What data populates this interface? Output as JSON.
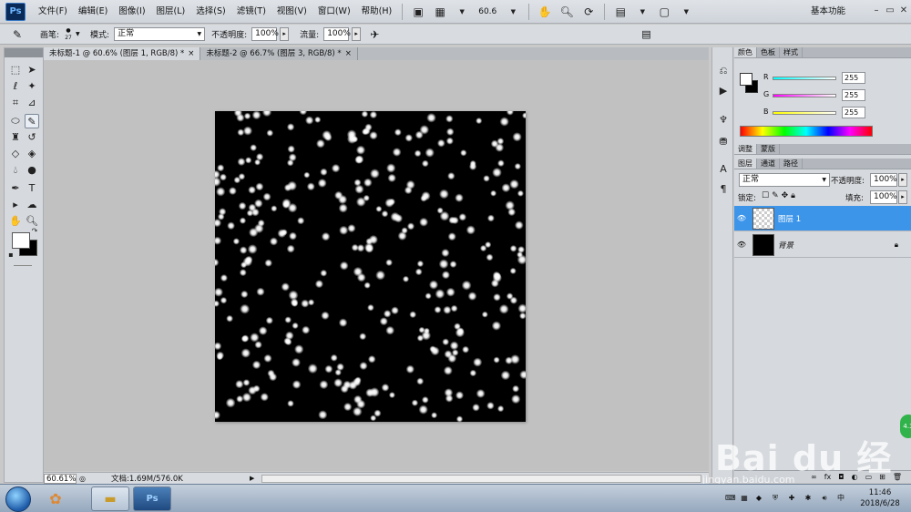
{
  "app": {
    "logo": "Ps"
  },
  "menu": {
    "items": [
      "文件(F)",
      "编辑(E)",
      "图像(I)",
      "图层(L)",
      "选择(S)",
      "滤镜(T)",
      "视图(V)",
      "窗口(W)",
      "帮助(H)"
    ],
    "zoom": "60.6",
    "workspace": "基本功能"
  },
  "options": {
    "brush_label": "画笔:",
    "brush_size": "27",
    "mode_label": "模式:",
    "mode_value": "正常",
    "opacity_label": "不透明度:",
    "opacity_value": "100%",
    "flow_label": "流量:",
    "flow_value": "100%"
  },
  "tabs": [
    {
      "title": "未标题-1 @ 60.6% (图层 1, RGB/8) *",
      "close": "×"
    },
    {
      "title": "未标题-2 @ 66.7% (图层 3, RGB/8) *",
      "close": "×"
    }
  ],
  "status": {
    "zoom": "60.61%",
    "doc": "文档:1.69M/576.0K"
  },
  "color_panel": {
    "tabs": [
      "颜色",
      "色板",
      "样式"
    ],
    "r_label": "R",
    "r_value": "255",
    "g_label": "G",
    "g_value": "255",
    "b_label": "B",
    "b_value": "255"
  },
  "adjust_panel": {
    "tabs": [
      "调整",
      "蒙版"
    ]
  },
  "layers_panel": {
    "tabs": [
      "图层",
      "通道",
      "路径"
    ],
    "blend_mode": "正常",
    "opacity_label": "不透明度:",
    "opacity_value": "100%",
    "lock_label": "锁定:",
    "fill_label": "填充:",
    "fill_value": "100%",
    "layers": [
      {
        "name": "图层 1",
        "selected": true
      },
      {
        "name": "背景",
        "selected": false
      }
    ]
  },
  "taskbar": {
    "time": "11:46",
    "date": "2018/6/28",
    "ps_label": "Ps"
  },
  "watermark": {
    "text": "Bai du 经验",
    "sub": "jingyan.baidu.com"
  },
  "colors": {
    "accent": "#3d95ea",
    "canvas_bg": "#c1c1c1",
    "image_bg": "#000000"
  },
  "icons": [
    "brush-icon",
    "hand-icon",
    "zoom-icon",
    "rotate-icon",
    "eye-icon",
    "lock-icon",
    "windows-start-icon",
    "explorer-icon"
  ]
}
